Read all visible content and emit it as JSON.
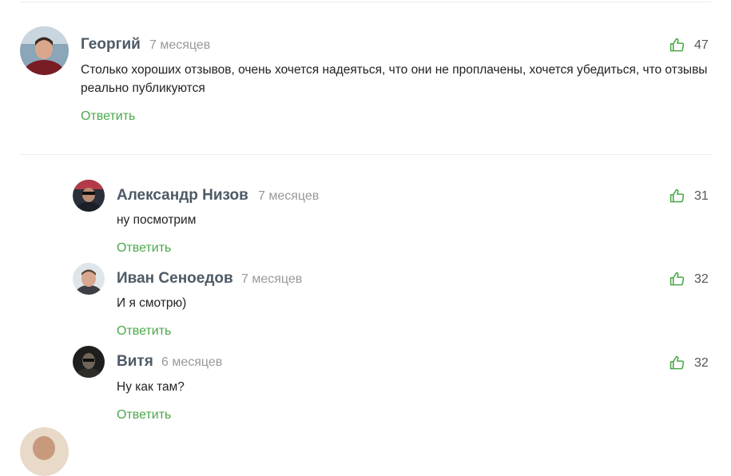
{
  "comments": [
    {
      "author": "Георгий",
      "time": "7 месяцев",
      "text": "Столько хороших отзывов, очень хочется надеяться, что они не проплачены, хочется убедиться, что отзывы реально публикуются",
      "likes": "47",
      "reply_label": "Ответить"
    }
  ],
  "replies": [
    {
      "author": "Александр Низов",
      "time": "7 месяцев",
      "text": "ну посмотрим",
      "likes": "31",
      "reply_label": "Ответить"
    },
    {
      "author": "Иван Сеноедов",
      "time": "7 месяцев",
      "text": "И я смотрю)",
      "likes": "32",
      "reply_label": "Ответить"
    },
    {
      "author": "Витя",
      "time": "6 месяцев",
      "text": "Ну как там?",
      "likes": "32",
      "reply_label": "Ответить"
    }
  ],
  "colors": {
    "author": "#4e5a66",
    "reply_link": "#4aa84a",
    "like_icon": "#4aa84a",
    "time": "#999999"
  },
  "icons": {
    "like": "thumbs-up-icon"
  }
}
